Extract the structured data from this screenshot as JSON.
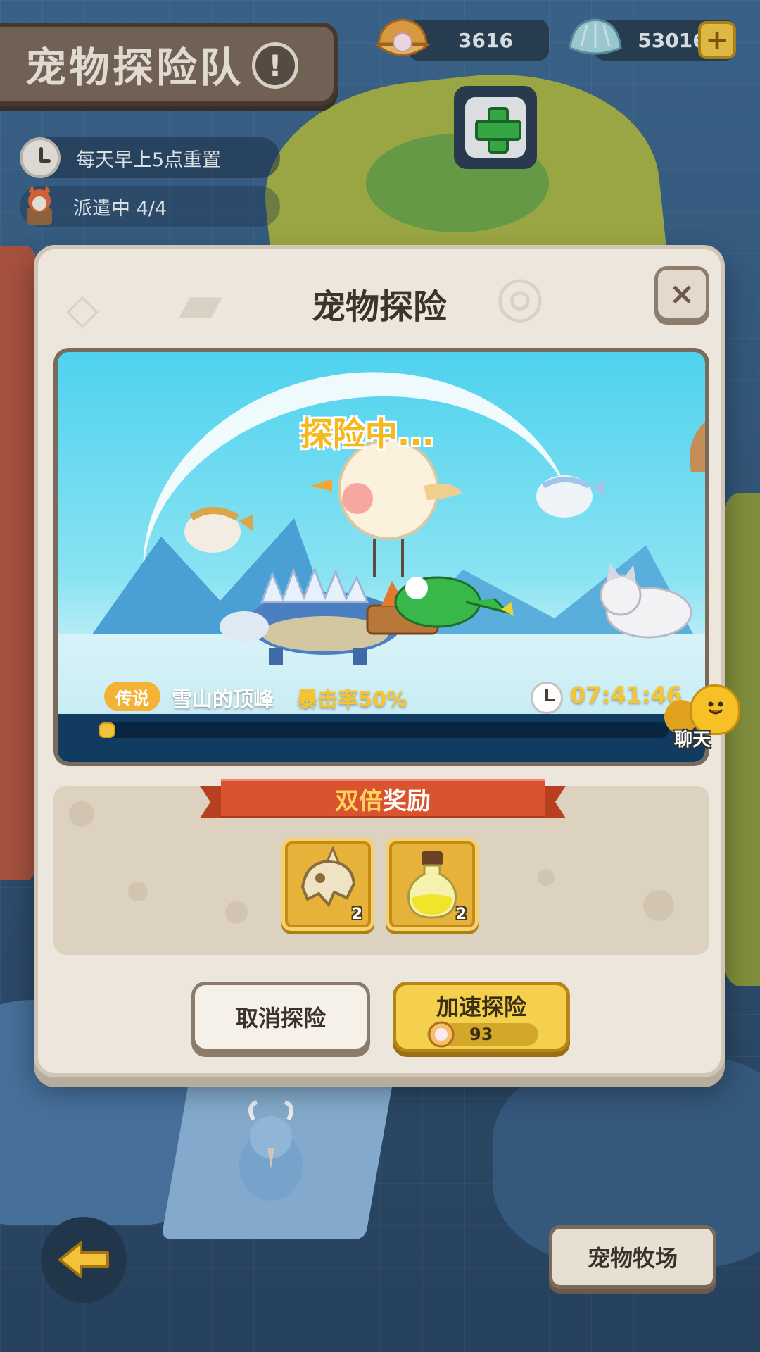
{
  "header": {
    "title": "宠物探险队",
    "info_glyph": "!"
  },
  "currencies": [
    {
      "name": "pearl",
      "value": "3616"
    },
    {
      "name": "shell",
      "value": "53016"
    }
  ],
  "info": {
    "reset_text": "每天早上5点重置",
    "dispatch_text": "派遣中 4/4"
  },
  "modal": {
    "title": "宠物探险",
    "close_glyph": "×",
    "scene": {
      "status": "探险中...",
      "rarity": "传说",
      "location": "雪山的顶峰",
      "bonus": "暴击率50%",
      "timer": "07:41:46",
      "progress": 0.03
    },
    "rewards": {
      "banner_highlight": "双倍",
      "banner_text": "奖励",
      "items": [
        {
          "icon": "fossil-skull-icon",
          "count": "2"
        },
        {
          "icon": "potion-bottle-icon",
          "count": "2"
        }
      ]
    },
    "cancel_label": "取消探险",
    "speedup_label": "加速探险",
    "speedup_cost": "93"
  },
  "chat": {
    "label": "聊天"
  },
  "bottom": {
    "ranch_label": "宠物牧场"
  },
  "colors": {
    "accent_gold": "#f9c52d",
    "ribbon_red": "#d9532e",
    "modal_bg": "#ece6dc"
  }
}
